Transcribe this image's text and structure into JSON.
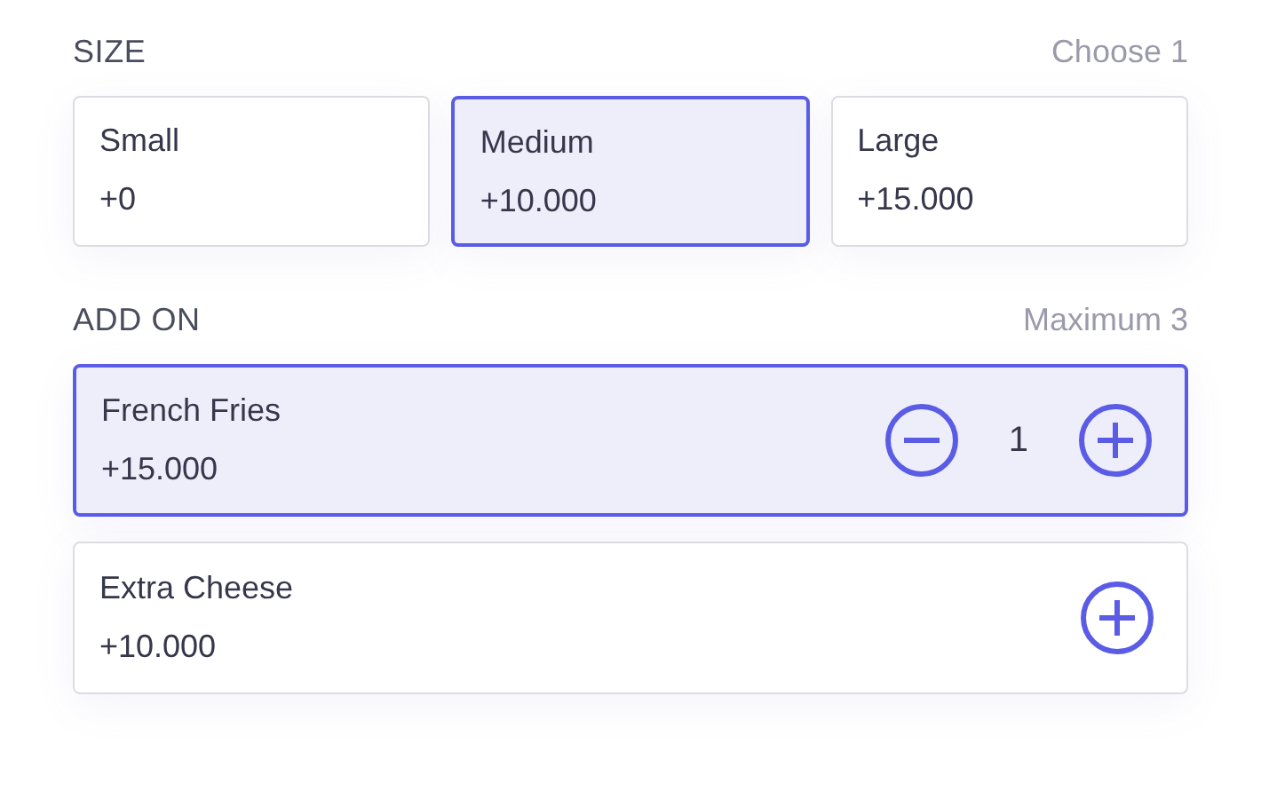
{
  "sections": [
    {
      "kind": "size",
      "title": "SIZE",
      "rule": "Choose 1",
      "options": [
        {
          "name": "Small",
          "price": "+0",
          "selected": false
        },
        {
          "name": "Medium",
          "price": "+10.000",
          "selected": true
        },
        {
          "name": "Large",
          "price": "+15.000",
          "selected": false
        }
      ]
    },
    {
      "kind": "addon",
      "title": "ADD ON",
      "rule": "Maximum 3",
      "options": [
        {
          "name": "French Fries",
          "price": "+15.000",
          "selected": true,
          "quantity": "1"
        },
        {
          "name": "Extra Cheese",
          "price": "+10.000",
          "selected": false
        }
      ]
    }
  ]
}
